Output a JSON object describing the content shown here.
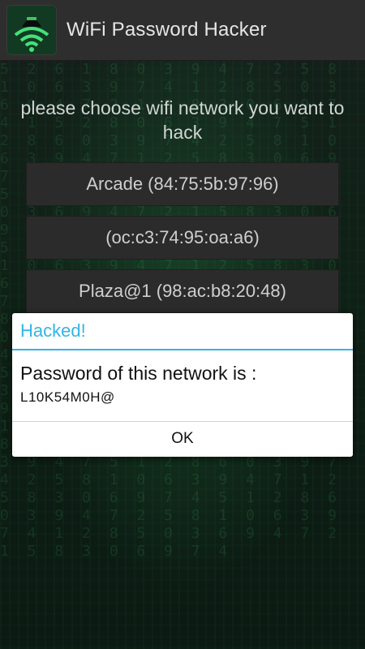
{
  "app": {
    "title": "WiFi Password Hacker",
    "icon": "hacker-wifi-icon"
  },
  "main": {
    "prompt": "please choose wifi network you want to hack",
    "networks": [
      {
        "label": "Arcade (84:75:5b:97:96)"
      },
      {
        "label": "(oc:c3:74:95:oa:a6)"
      },
      {
        "label": "Plaza@1 (98:ac:b8:20:48)"
      }
    ]
  },
  "dialog": {
    "title": "Hacked!",
    "message": "Password of this network is :",
    "password": "L10K54M0H@",
    "ok_label": "OK"
  },
  "colors": {
    "accent": "#33b5e5",
    "action_bar": "#2e2e2e",
    "button_bg": "#2b2b2b",
    "background": "#0f2016"
  }
}
